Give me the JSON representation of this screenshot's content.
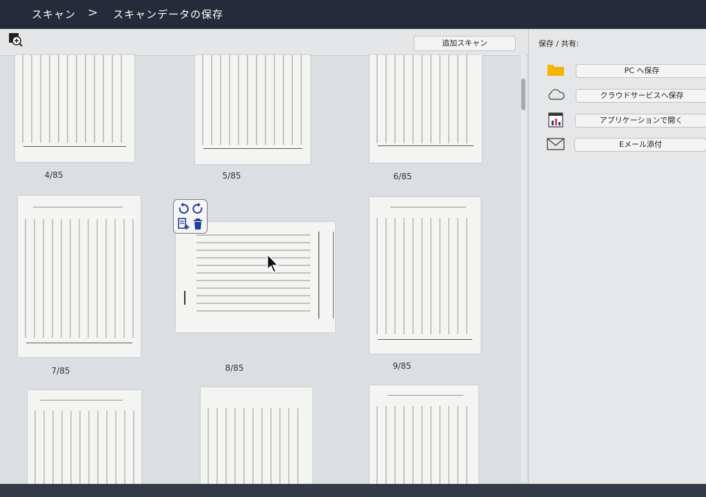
{
  "header": {
    "breadcrumb": [
      "スキャン",
      "スキャンデータの保存"
    ],
    "separator": ">"
  },
  "toolbar": {
    "zoom_icon": "zoom-in-icon",
    "add_scan_label": "追加スキャン"
  },
  "pages": [
    {
      "label": "4/85"
    },
    {
      "label": "5/85"
    },
    {
      "label": "6/85"
    },
    {
      "label": "7/85"
    },
    {
      "label": "8/85"
    },
    {
      "label": "9/85"
    }
  ],
  "page_tools": {
    "icons": [
      "rotate-left-icon",
      "rotate-right-icon",
      "insert-page-icon",
      "delete-icon"
    ]
  },
  "sidebar": {
    "title": "保存 / 共有:",
    "actions": [
      {
        "icon": "folder-icon",
        "label": "PC へ保存"
      },
      {
        "icon": "cloud-icon",
        "label": "クラウドサービスへ保存"
      },
      {
        "icon": "application-icon",
        "label": "アプリケーションで開く"
      },
      {
        "icon": "mail-icon",
        "label": "Eメール添付"
      }
    ]
  },
  "colors": {
    "header_bg": "#252b3a",
    "folder": "#f5b400",
    "icon_blue": "#1f3f8f"
  }
}
